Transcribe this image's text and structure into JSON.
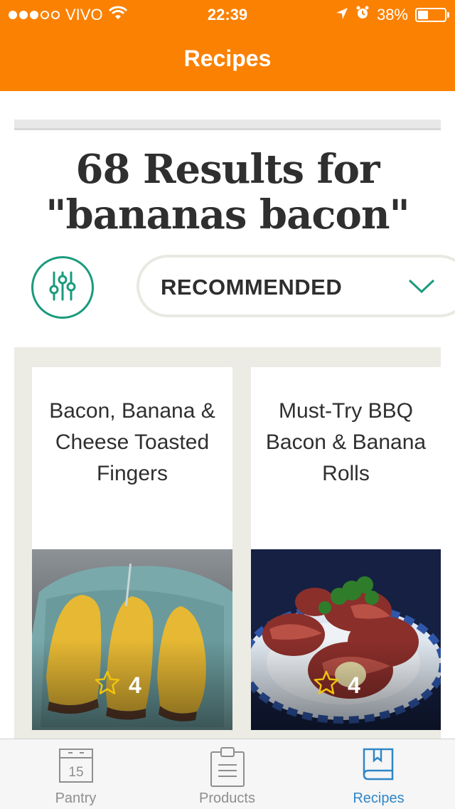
{
  "status_bar": {
    "carrier": "VIVO",
    "time": "22:39",
    "battery": "38%",
    "icons": [
      "signal-dots-icon",
      "wifi-icon",
      "location-arrow-icon",
      "alarm-icon",
      "battery-icon"
    ]
  },
  "nav": {
    "title": "Recipes"
  },
  "results": {
    "line1": "68 Results for",
    "line2": "\"bananas bacon\""
  },
  "controls": {
    "filter_icon": "sliders-icon",
    "sort_label": "RECOMMENDED",
    "accent_color": "#1a9a7d"
  },
  "recipes": [
    {
      "title": "Bacon, Banana & Cheese Toasted Fingers",
      "rating": "4"
    },
    {
      "title": "Must-Try BBQ Bacon & Banana Rolls",
      "rating": "4"
    }
  ],
  "tabbar": {
    "tabs": [
      {
        "label": "Pantry",
        "icon": "calendar-icon",
        "icon_text": "15"
      },
      {
        "label": "Products",
        "icon": "clipboard-icon"
      },
      {
        "label": "Recipes",
        "icon": "book-icon"
      }
    ],
    "active_color": "#2f86c8"
  },
  "colors": {
    "brand_orange": "#fb8102"
  }
}
